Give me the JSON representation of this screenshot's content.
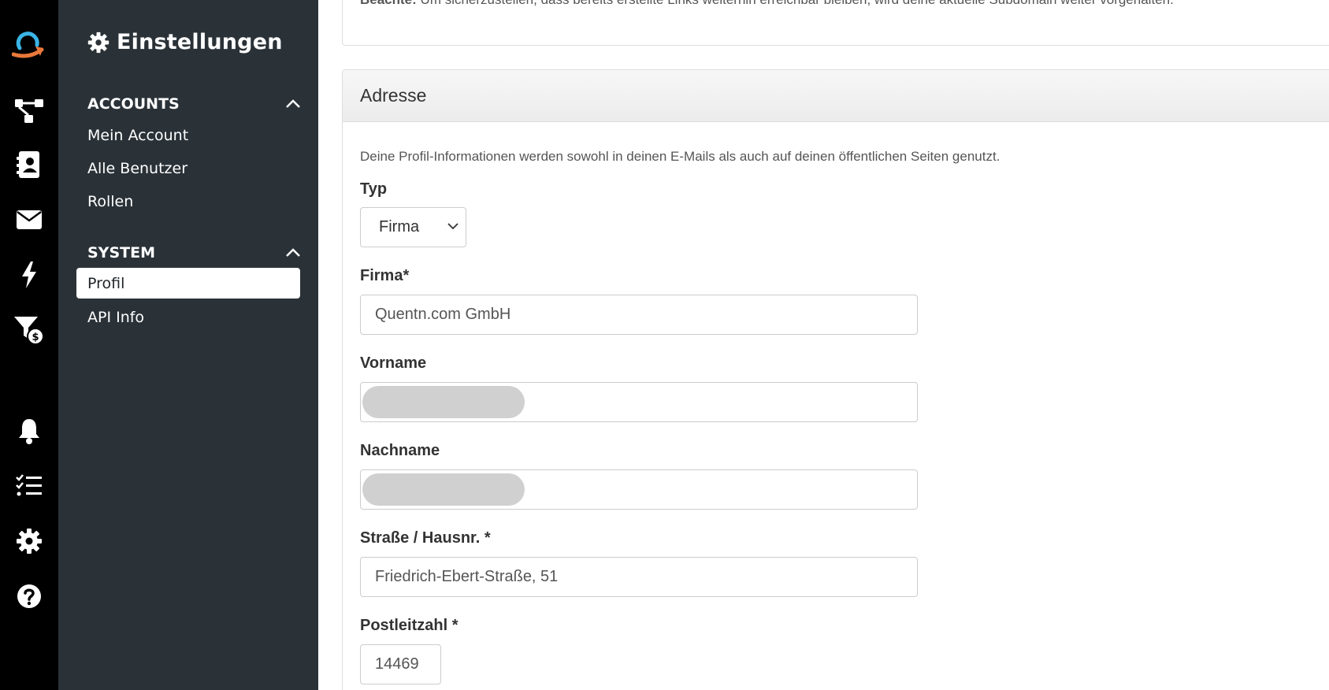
{
  "rail": {
    "icons": [
      "logo-icon",
      "workflow-icon",
      "contacts-icon",
      "mail-icon",
      "lightning-icon",
      "funnel-dollar-icon",
      "bell-icon",
      "checklist-icon",
      "gear-icon",
      "help-icon"
    ],
    "accent": "#e8783a",
    "logo_color": "#3ab4e6"
  },
  "sidebar": {
    "title": "Einstellungen",
    "sections": [
      {
        "label": "ACCOUNTS",
        "items": [
          "Mein Account",
          "Alle Benutzer",
          "Rollen"
        ]
      },
      {
        "label": "SYSTEM",
        "items": [
          "Profil",
          "API Info"
        ]
      }
    ],
    "active_item": "Profil"
  },
  "main": {
    "note_bold": "Beachte:",
    "note_text": " Um sicherzustellen, dass bereits erstellte Links weiterhin erreichbar bleiben, wird deine aktuelle Subdomain weiter vorgehalten.",
    "panel_title": "Adresse",
    "description": "Deine Profil-Informationen werden sowohl in deinen E-Mails als auch auf deinen öffentlichen Seiten genutzt.",
    "fields": {
      "typ_label": "Typ",
      "typ_value": "Firma",
      "firma_label": "Firma*",
      "firma_value": "Quentn.com GmbH",
      "vorname_label": "Vorname",
      "nachname_label": "Nachname",
      "strasse_label": "Straße / Hausnr. *",
      "strasse_value": "Friedrich-Ebert-Straße, 51",
      "plz_label": "Postleitzahl *",
      "plz_value": "14469"
    }
  }
}
